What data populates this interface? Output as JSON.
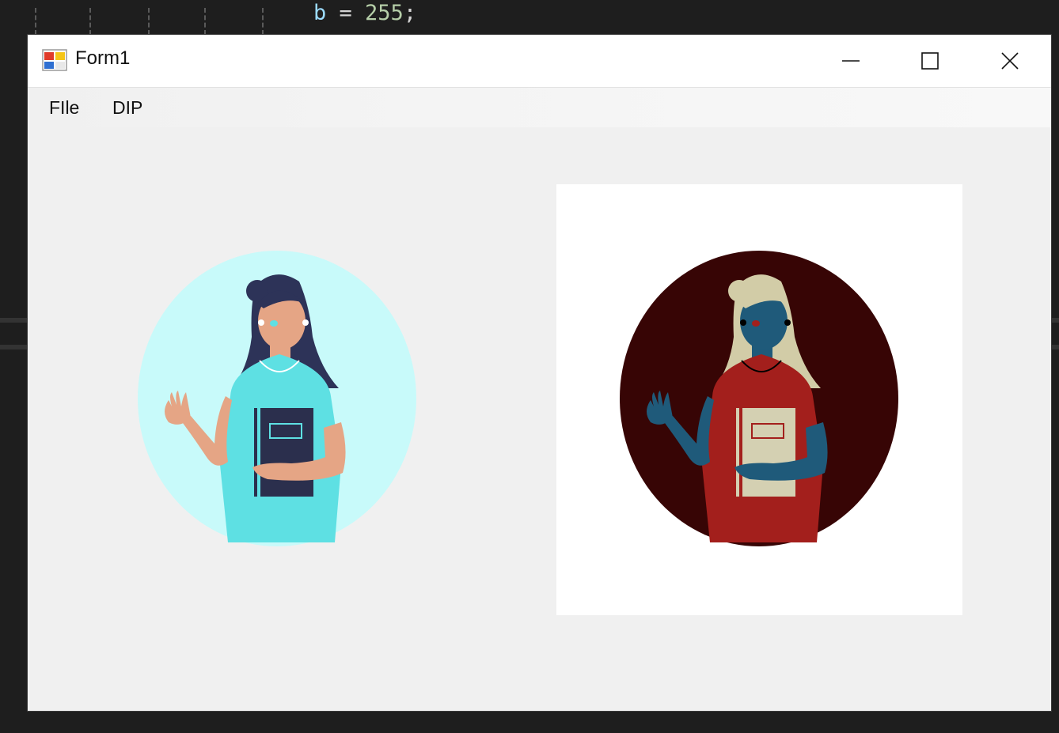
{
  "background_editor": {
    "code_text": "b = 255;",
    "code_var": "b",
    "code_eq": " = ",
    "code_num": "255",
    "code_end": ";"
  },
  "window": {
    "title": "Form1",
    "icon": "winforms-app-icon",
    "controls": {
      "minimize": "minimize-icon",
      "maximize": "maximize-icon",
      "close": "close-icon"
    }
  },
  "menu": {
    "items": [
      {
        "label": "FIle"
      },
      {
        "label": "DIP"
      }
    ]
  },
  "images": {
    "original": {
      "description_icon": "woman-holding-book-illustration",
      "colors": {
        "circle": "#c8fafa",
        "shirt": "#5ee0e3",
        "skin": "#e5a585",
        "hair": "#2d3358",
        "book": "#2b2f4d"
      }
    },
    "processed": {
      "description_icon": "color-inverted-woman-holding-book-illustration",
      "colors": {
        "circle": "#370505",
        "shirt": "#a31f1c",
        "skin": "#1f5a7a",
        "hair": "#d2cca7",
        "book": "#d4d0b2",
        "frame": "#ffffff"
      }
    }
  }
}
